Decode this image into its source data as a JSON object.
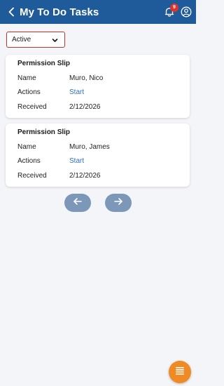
{
  "header": {
    "title": "My To Do Tasks",
    "notification_count": "9",
    "back_icon": "chevron-left-icon",
    "notification_icon": "bell-icon",
    "profile_icon": "user-icon"
  },
  "filter": {
    "selected": "Active",
    "icon": "chevron-down-icon"
  },
  "tasks": [
    {
      "title": "Permission Slip",
      "name_label": "Name",
      "name": "Muro, Nico",
      "actions_label": "Actions",
      "action": "Start",
      "received_label": "Received",
      "received": "2/12/2026"
    },
    {
      "title": "Permission Slip",
      "name_label": "Name",
      "name": "Muro, James",
      "actions_label": "Actions",
      "action": "Start",
      "received_label": "Received",
      "received": "2/12/2026"
    }
  ],
  "pagination": {
    "prev_icon": "arrow-left-icon",
    "next_icon": "arrow-right-icon"
  },
  "fab": {
    "icon": "menu-list-icon"
  },
  "colors": {
    "header_bg": "#1f5b9b",
    "page_bg": "#f4f5f8",
    "link": "#2e6fb7",
    "badge": "#e0312c",
    "filter_border": "#c9302c",
    "pager_button": "#7d97b8",
    "fab": "#f08a24"
  }
}
